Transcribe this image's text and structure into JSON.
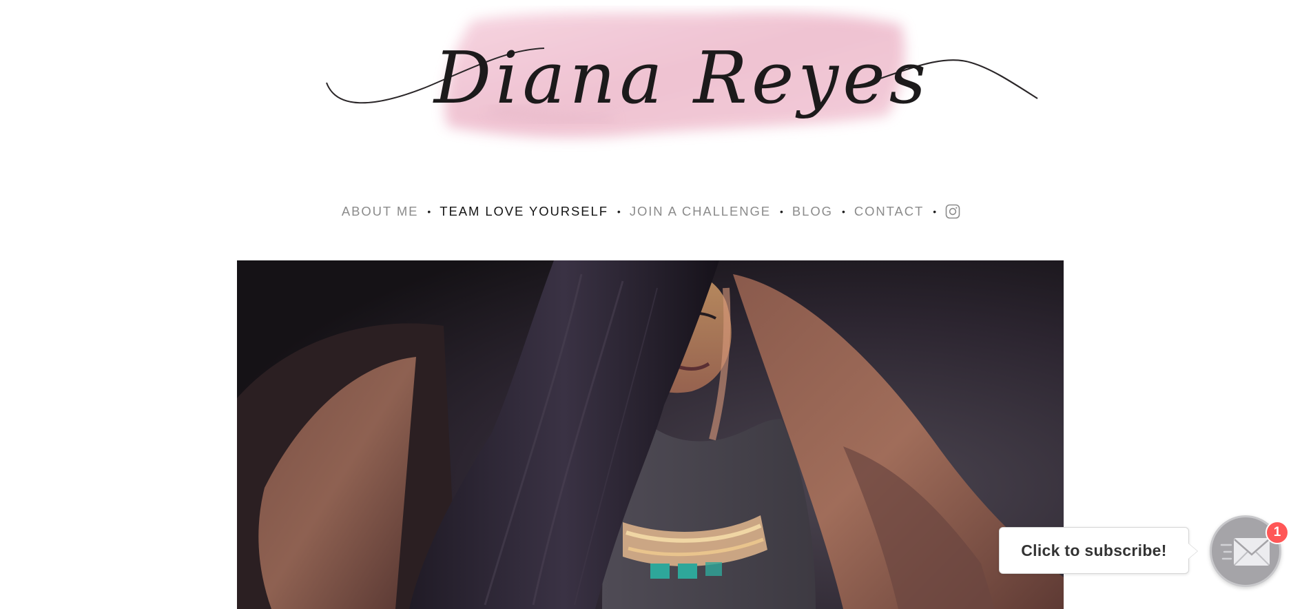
{
  "site": {
    "logo_text": "Diana Reyes"
  },
  "nav": {
    "items": [
      {
        "label": "ABOUT ME",
        "active": false
      },
      {
        "label": "TEAM LOVE YOURSELF",
        "active": true
      },
      {
        "label": "JOIN A CHALLENGE",
        "active": false
      },
      {
        "label": "BLOG",
        "active": false
      },
      {
        "label": "CONTACT",
        "active": false
      }
    ],
    "separator": "•",
    "social_icon": "instagram-icon"
  },
  "hero": {
    "icon": "hero-photo"
  },
  "subscribe": {
    "prompt": "Click to subscribe!",
    "badge_count": "1",
    "icon": "envelope-icon",
    "colors": {
      "button": "#a5a4a8",
      "badge": "#ff5757"
    }
  },
  "colors": {
    "nav_text": "#8b8b8b",
    "nav_active": "#141414",
    "logo_wash": "#f2c4d4"
  }
}
